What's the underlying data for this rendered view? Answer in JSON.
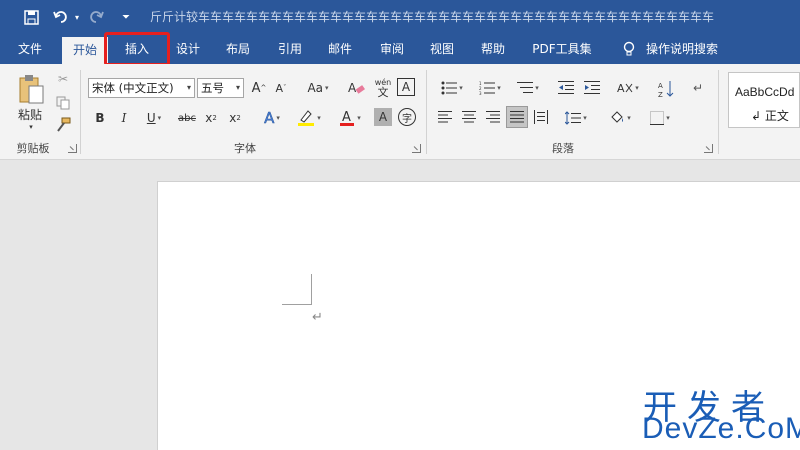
{
  "titlebar": {
    "title": "斤斤计较车车车车车车车车车车车车车车车车车车车车车车车车车车车车车车车车车车车车车车车车车车车"
  },
  "tabs": [
    "文件",
    "开始",
    "插入",
    "设计",
    "布局",
    "引用",
    "邮件",
    "审阅",
    "视图",
    "帮助",
    "PDF工具集",
    "操作说明搜索"
  ],
  "ribbon": {
    "clipboard": {
      "paste_label": "粘贴",
      "group_label": "剪贴板"
    },
    "font": {
      "font_name": "宋体 (中文正文)",
      "font_size": "五号",
      "group_label": "字体",
      "change_case": "Aa",
      "phonetic_top": "wén",
      "phonetic_bottom": "文"
    },
    "paragraph": {
      "group_label": "段落"
    },
    "styles": {
      "sample": "AaBbCcDd",
      "normal_label": "正文"
    }
  },
  "colors": {
    "accent": "#2b579a",
    "highlight": "#e5201f",
    "watermark": "#1a5db6"
  },
  "watermark": {
    "line1": "开发者",
    "line2": "DevZe.CoM"
  }
}
